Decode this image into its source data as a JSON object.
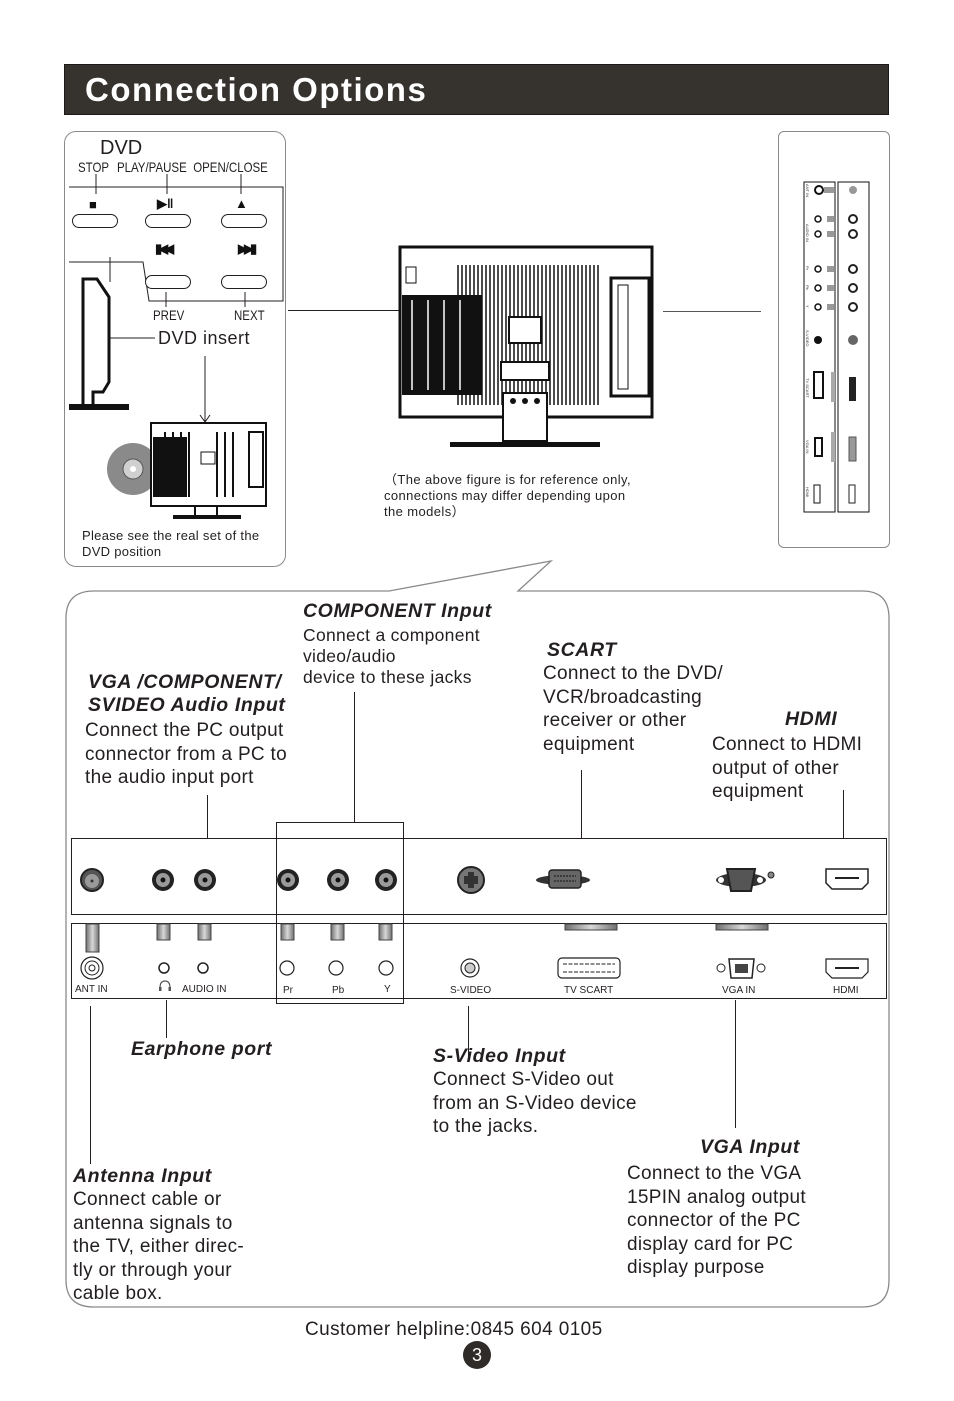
{
  "page": {
    "title": "Connection Options",
    "footer_helpline": "Customer helpline:0845 604 0105",
    "page_number": "3",
    "header_bg_color": "#36332f"
  },
  "dvd_panel": {
    "heading": "DVD",
    "button_labels": [
      "STOP",
      "PLAY/PAUSE",
      "OPEN/CLOSE",
      "PREV",
      "NEXT"
    ],
    "button_icons": [
      "stop-icon",
      "play-pause-icon",
      "eject-icon",
      "previous-icon",
      "next-icon"
    ],
    "insert_label": "DVD insert",
    "note_line1": "Please see the real set of the",
    "note_line2": "DVD position"
  },
  "center_figure": {
    "note_line1": "（The above figure is for reference only,",
    "note_line2": "connections may differ depending upon",
    "note_line3": "the models）"
  },
  "side_panel": {
    "ports": [
      "ANT IN",
      "AUDIO IN",
      "Pr",
      "Pb",
      "Y",
      "S-VIDEO",
      "TV SCART",
      "VGA IN",
      "HDMI"
    ]
  },
  "callouts": {
    "component": {
      "title": "COMPONENT  Input",
      "lines": [
        "Connect a component",
        "video/audio",
        "device to these jacks"
      ]
    },
    "audio": {
      "title_line1": "VGA /COMPONENT/",
      "title_line2": "SVIDEO Audio Input",
      "lines": [
        "Connect the PC output",
        "connector from a PC to",
        "the audio input port"
      ]
    },
    "scart": {
      "title": "SCART",
      "lines": [
        "Connect to the DVD/",
        "VCR/broadcasting",
        "receiver or other",
        "equipment"
      ]
    },
    "hdmi": {
      "title": "HDMI",
      "lines": [
        "Connect to HDMI",
        "output of other",
        "equipment"
      ]
    },
    "earphone": {
      "title": "Earphone port"
    },
    "svideo": {
      "title": "S-Video Input",
      "lines": [
        "Connect S-Video out",
        "from an S-Video device",
        "to the jacks."
      ]
    },
    "vga": {
      "title": "VGA  Input",
      "lines": [
        "Connect to the VGA",
        "15PIN analog output",
        "connector of the PC",
        "display card for PC",
        "display purpose"
      ]
    },
    "antenna": {
      "title": "Antenna Input",
      "lines": [
        "Connect cable or",
        "antenna signals to",
        "the TV, either direc-",
        "tly or through your",
        "cable box."
      ]
    }
  },
  "port_panel": {
    "labels": {
      "ant_in": "ANT IN",
      "audio_in": "AUDIO IN",
      "pr": "Pr",
      "pb": "Pb",
      "y": "Y",
      "svideo": "S-VIDEO",
      "tv_scart": "TV SCART",
      "vga_in": "VGA IN",
      "hdmi": "HDMI"
    }
  }
}
